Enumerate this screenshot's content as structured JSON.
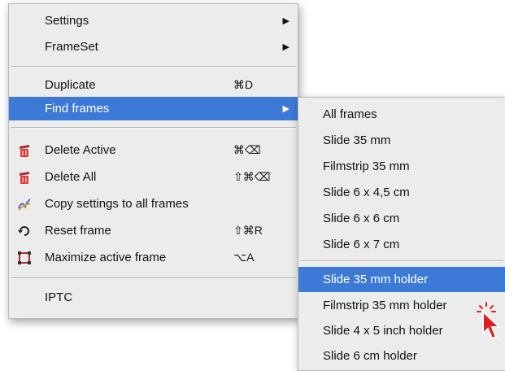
{
  "main_menu": {
    "items": [
      {
        "label": "Settings",
        "shortcut": "",
        "submenu": true
      },
      {
        "label": "FrameSet",
        "shortcut": "",
        "submenu": true
      },
      {
        "label": "Duplicate",
        "shortcut": "⌘D"
      },
      {
        "label": "Find frames",
        "shortcut": "",
        "submenu": true,
        "highlighted": true
      },
      {
        "label": "Delete Active",
        "shortcut": "⌘⌫",
        "icon": "trash-red-icon"
      },
      {
        "label": "Delete All",
        "shortcut": "⇧⌘⌫",
        "icon": "trash-red-icon"
      },
      {
        "label": "Copy settings to all frames",
        "shortcut": "",
        "icon": "copy-settings-icon"
      },
      {
        "label": "Reset frame",
        "shortcut": "⇧⌘R",
        "icon": "reset-icon"
      },
      {
        "label": "Maximize active frame",
        "shortcut": "⌥A",
        "icon": "maximize-icon"
      },
      {
        "label": "IPTC",
        "shortcut": ""
      }
    ],
    "arrow_glyph": "▶"
  },
  "sub_menu": {
    "items": [
      {
        "label": "All frames"
      },
      {
        "label": "Slide 35 mm"
      },
      {
        "label": "Filmstrip 35 mm"
      },
      {
        "label": "Slide 6 x 4,5 cm"
      },
      {
        "label": "Slide 6 x 6 cm"
      },
      {
        "label": "Slide 6 x 7 cm"
      },
      {
        "label": "Slide 35 mm holder",
        "highlighted": true
      },
      {
        "label": "Filmstrip 35 mm holder"
      },
      {
        "label": "Slide 4 x 5 inch holder"
      },
      {
        "label": "Slide 6 cm holder"
      }
    ]
  },
  "colors": {
    "menu_bg": "#ececec",
    "highlight": "#3d79d6",
    "cursor": "#e02020"
  }
}
